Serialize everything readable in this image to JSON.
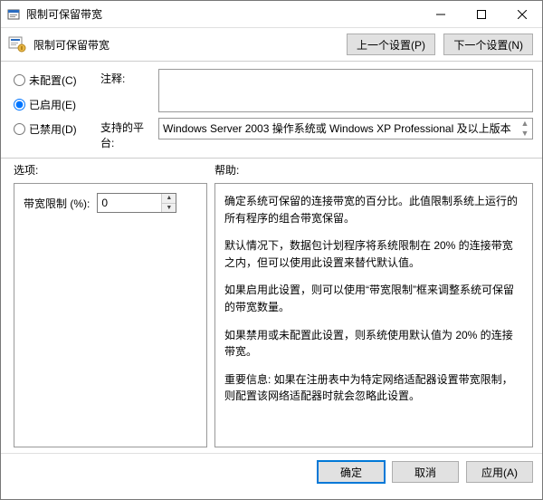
{
  "window": {
    "title": "限制可保留带宽"
  },
  "header": {
    "title": "限制可保留带宽",
    "prev": "上一个设置(P)",
    "next": "下一个设置(N)"
  },
  "radios": {
    "not_configured": "未配置(C)",
    "enabled": "已启用(E)",
    "disabled": "已禁用(D)",
    "selected": "enabled"
  },
  "config": {
    "comment_label": "注释:",
    "comment_value": "",
    "platform_label": "支持的平台:",
    "platform_value": "Windows Server 2003 操作系统或 Windows XP Professional 及以上版本"
  },
  "sections": {
    "options_label": "选项:",
    "help_label": "帮助:"
  },
  "options": {
    "bandwidth_label": "带宽限制 (%):",
    "bandwidth_value": "0"
  },
  "help": {
    "p1": "确定系统可保留的连接带宽的百分比。此值限制系统上运行的所有程序的组合带宽保留。",
    "p2": "默认情况下，数据包计划程序将系统限制在 20% 的连接带宽之内，但可以使用此设置来替代默认值。",
    "p3": "如果启用此设置，则可以使用“带宽限制”框来调整系统可保留的带宽数量。",
    "p4": "如果禁用或未配置此设置，则系统使用默认值为 20% 的连接带宽。",
    "p5": "重要信息: 如果在注册表中为特定网络适配器设置带宽限制，则配置该网络适配器时就会忽略此设置。"
  },
  "footer": {
    "ok": "确定",
    "cancel": "取消",
    "apply": "应用(A)"
  }
}
